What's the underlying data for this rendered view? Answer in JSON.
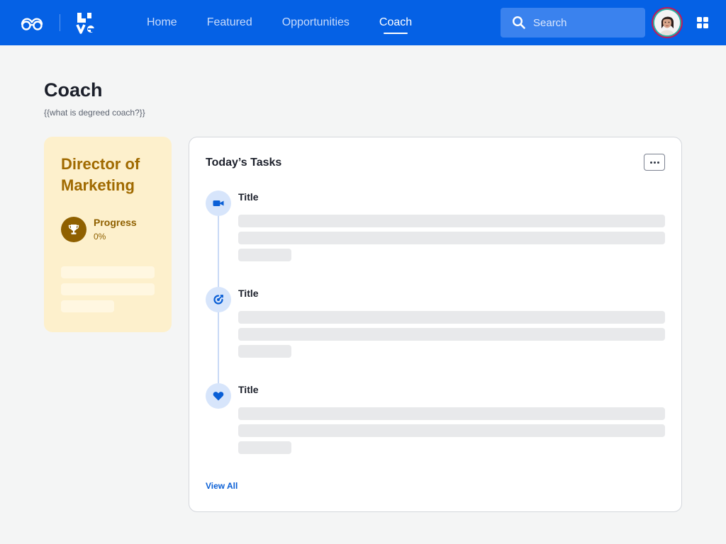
{
  "header": {
    "glasses_logo_icon": "glasses-logo-icon",
    "brand_logo_icon": "brand-logo-icon",
    "nav": [
      {
        "label": "Home",
        "active": false
      },
      {
        "label": "Featured",
        "active": false
      },
      {
        "label": "Opportunities",
        "active": false
      },
      {
        "label": "Coach",
        "active": true
      }
    ],
    "search": {
      "placeholder": "Search",
      "value": "",
      "icon": "search-icon"
    },
    "avatar_icon": "avatar",
    "apps_icon": "apps-grid-icon",
    "colors": {
      "bar": "#0561e5",
      "search_bg": "#3a82ee"
    }
  },
  "page": {
    "title": "Coach",
    "subtitle": "{{what is degreed coach?}}"
  },
  "role_card": {
    "title": "Director of Marketing",
    "progress_label": "Progress",
    "progress_value": "0%",
    "icon": "trophy-icon",
    "colors": {
      "bg": "#fdf0cc",
      "text": "#a06a00"
    }
  },
  "tasks": {
    "title": "Today’s Tasks",
    "more_icon": "more-options-icon",
    "items": [
      {
        "title": "Title",
        "icon": "video-icon"
      },
      {
        "title": "Title",
        "icon": "target-icon"
      },
      {
        "title": "Title",
        "icon": "heart-icon"
      }
    ],
    "view_all_label": "View All",
    "colors": {
      "accent": "#0a5fd6",
      "icon_bg": "#d7e5fb"
    }
  }
}
